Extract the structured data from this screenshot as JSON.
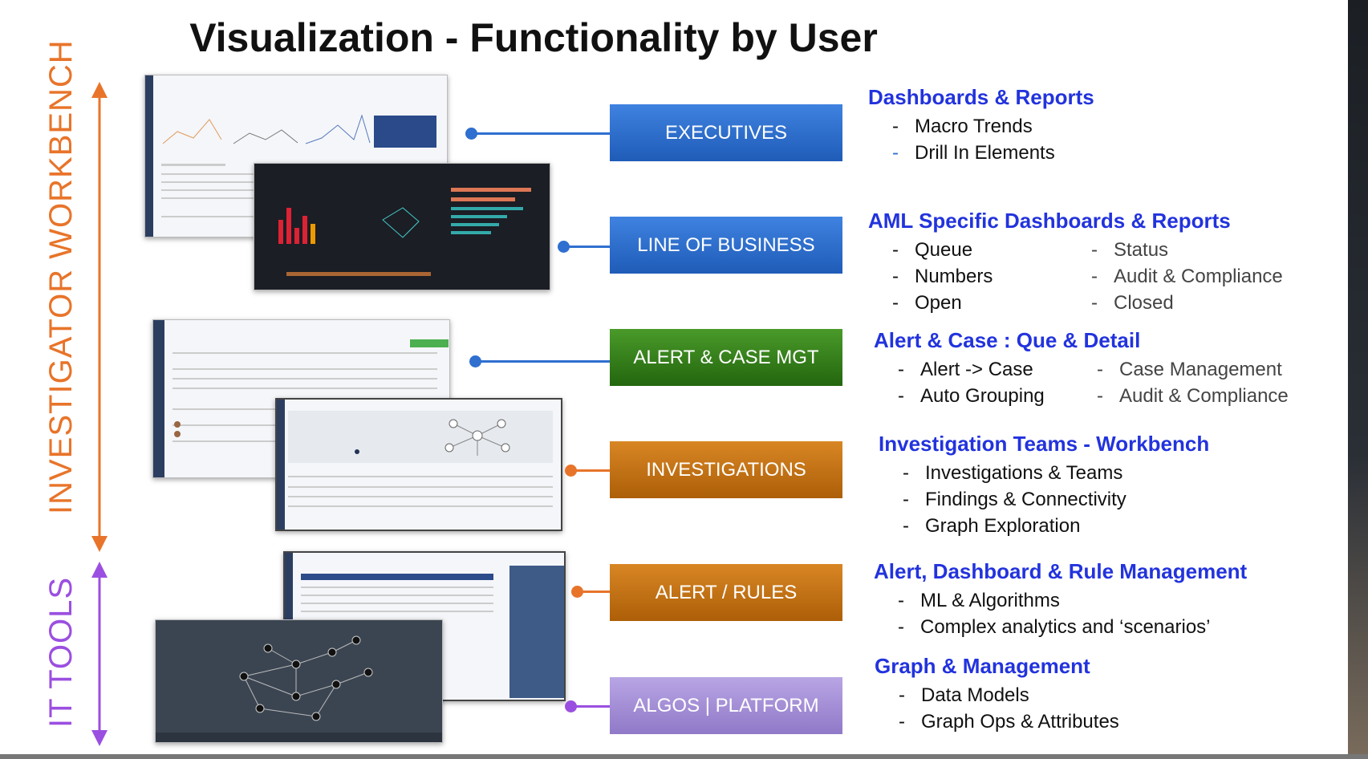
{
  "title": "Visualization - Functionality by User",
  "side_labels": {
    "workbench": "INVESTIGATOR WORKBENCH",
    "it_tools": "IT TOOLS"
  },
  "colors": {
    "workbench": "#e8742a",
    "it_tools": "#9b4fe0",
    "heading": "#2233dd"
  },
  "roles": [
    {
      "label": "EXECUTIVES",
      "color": "#2f6fd0"
    },
    {
      "label": "LINE OF BUSINESS",
      "color": "#2f6fd0"
    },
    {
      "label": "ALERT & CASE MGT",
      "color": "#3a8a1e"
    },
    {
      "label": "INVESTIGATIONS",
      "color": "#c87414"
    },
    {
      "label": "ALERT / RULES",
      "color": "#c87414"
    },
    {
      "label": "ALGOS | PLATFORM",
      "color": "#a58fd6"
    }
  ],
  "sections": [
    {
      "heading": "Dashboards & Reports",
      "col1": [
        "Macro Trends",
        "Drill In Elements"
      ],
      "col2": []
    },
    {
      "heading": "AML Specific Dashboards & Reports",
      "col1": [
        "Queue",
        "Numbers",
        "Open"
      ],
      "col2": [
        "Status",
        "Audit & Compliance",
        "Closed"
      ]
    },
    {
      "heading": "Alert & Case : Que & Detail",
      "col1": [
        "Alert -> Case",
        "Auto Grouping"
      ],
      "col2": [
        "Case Management",
        "Audit & Compliance"
      ]
    },
    {
      "heading": "Investigation Teams - Workbench",
      "col1": [
        "Investigations & Teams",
        "Findings & Connectivity",
        "Graph Exploration"
      ],
      "col2": []
    },
    {
      "heading": "Alert, Dashboard & Rule Management",
      "col1": [
        "ML & Algorithms",
        "Complex analytics and ‘scenarios’"
      ],
      "col2": []
    },
    {
      "heading": "Graph & Management",
      "col1": [
        "Data Models",
        "Graph Ops & Attributes"
      ],
      "col2": []
    }
  ],
  "bullet": "-"
}
